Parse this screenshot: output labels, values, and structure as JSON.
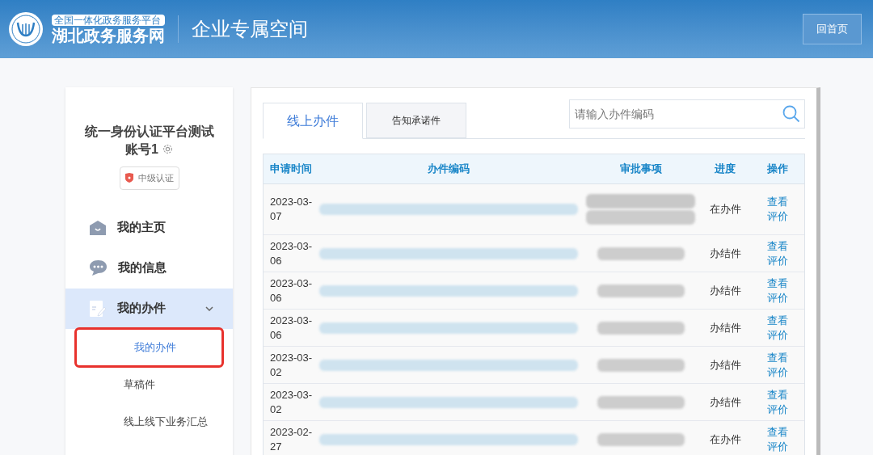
{
  "header": {
    "logo_tagline": "全国一体化政务服务平台",
    "logo_name": "湖北政务服务网",
    "title": "企业专属空间",
    "home_button": "回首页"
  },
  "profile": {
    "name": "统一身份认证平台测试账号1",
    "badge": "中级认证"
  },
  "sidebar": {
    "items": [
      {
        "label": "我的主页",
        "selected": false
      },
      {
        "label": "我的信息",
        "selected": false
      },
      {
        "label": "我的办件",
        "expanded": true,
        "selected": true,
        "children": [
          {
            "label": "我的办件",
            "selected": true
          },
          {
            "label": "草稿件",
            "selected": false
          },
          {
            "label": "线上线下业务汇总",
            "selected": false
          }
        ]
      }
    ]
  },
  "tabs": [
    {
      "label": "线上办件",
      "selected": true
    },
    {
      "label": "告知承诺件",
      "selected": false
    }
  ],
  "search": {
    "placeholder": "请输入办件编码"
  },
  "table": {
    "columns": [
      "申请时间",
      "办件编码",
      "审批事项",
      "进度",
      "操作"
    ],
    "rows": [
      {
        "date": "2023-03-07",
        "progress": "在办件",
        "actions": [
          "查看",
          "评价"
        ]
      },
      {
        "date": "2023-03-06",
        "progress": "办结件",
        "actions": [
          "查看",
          "评价"
        ]
      },
      {
        "date": "2023-03-06",
        "progress": "办结件",
        "actions": [
          "查看",
          "评价"
        ]
      },
      {
        "date": "2023-03-06",
        "progress": "办结件",
        "actions": [
          "查看",
          "评价"
        ]
      },
      {
        "date": "2023-03-02",
        "progress": "办结件",
        "actions": [
          "查看",
          "评价"
        ]
      },
      {
        "date": "2023-03-02",
        "progress": "办结件",
        "actions": [
          "查看",
          "评价"
        ]
      },
      {
        "date": "2023-02-27",
        "progress": "在办件",
        "actions": [
          "查看",
          "评价"
        ]
      }
    ]
  }
}
